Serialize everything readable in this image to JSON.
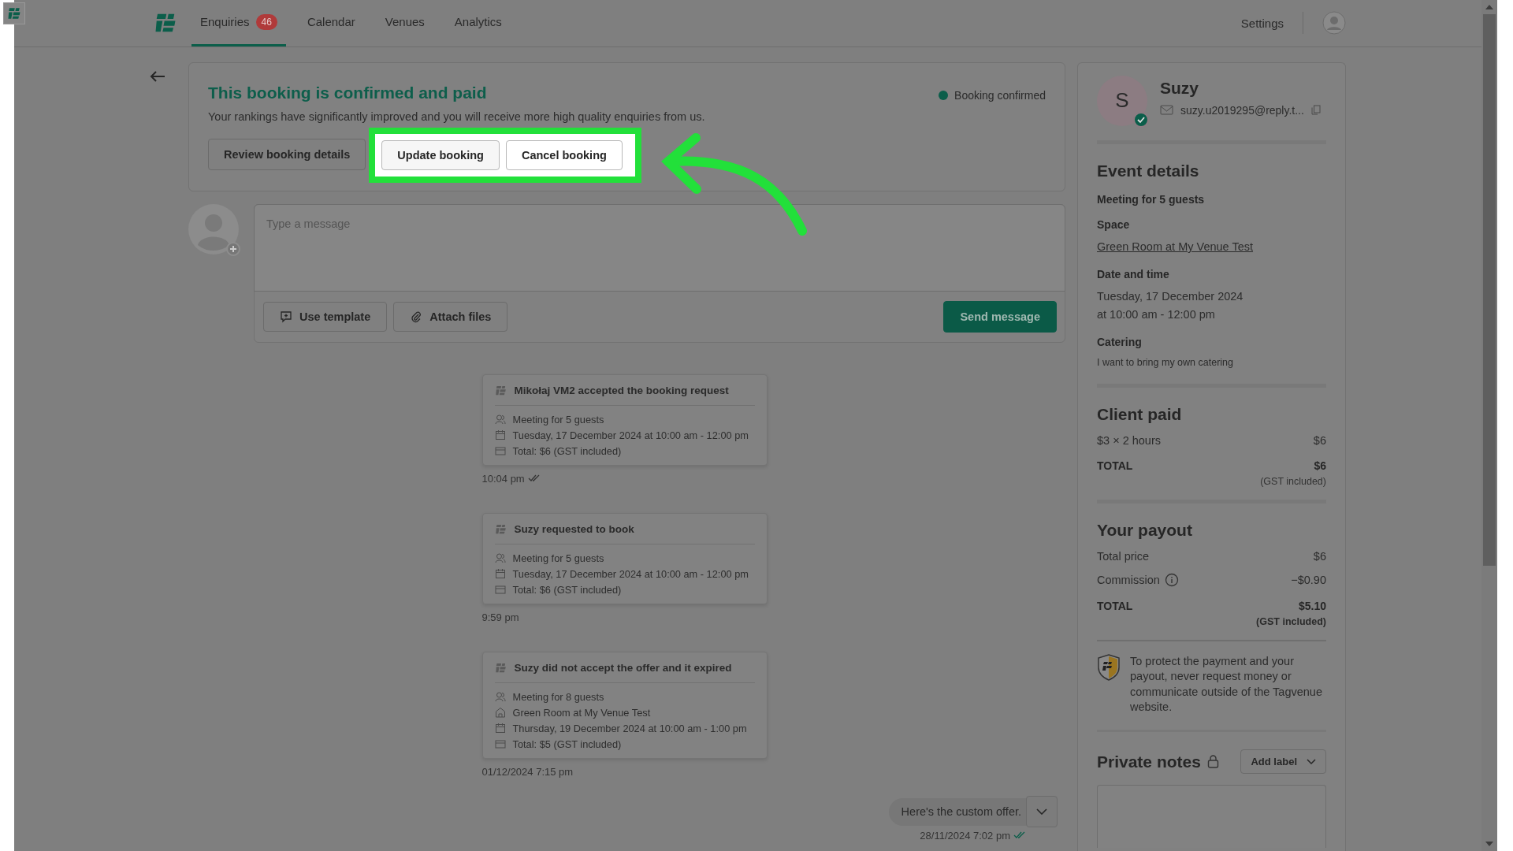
{
  "nav": {
    "tabs": [
      {
        "label": "Enquiries",
        "badge": "46",
        "selected": true
      },
      {
        "label": "Calendar",
        "selected": false
      },
      {
        "label": "Venues",
        "selected": false
      },
      {
        "label": "Analytics",
        "selected": false
      }
    ],
    "settings": "Settings"
  },
  "banner": {
    "title": "This booking is confirmed and paid",
    "subtitle": "Your rankings have significantly improved and you will receive more high quality enquiries from us.",
    "status": {
      "label": "Booking confirmed",
      "color": "#0b5e4a"
    },
    "buttons": [
      {
        "label": "Review booking details",
        "highlighted": false
      },
      {
        "label": "Update booking",
        "highlighted": true
      },
      {
        "label": "Cancel booking",
        "highlighted": true
      }
    ]
  },
  "composer": {
    "placeholder": "Type a message",
    "tools": [
      {
        "kind": "template",
        "label": "Use template"
      },
      {
        "kind": "attach",
        "label": "Attach files"
      }
    ],
    "send": "Send message"
  },
  "timeline": [
    {
      "title": "Mikołaj VM2 accepted the booking request",
      "lines": [
        {
          "kind": "guests",
          "text": "Meeting for 5 guests"
        },
        {
          "kind": "date",
          "text": "Tuesday, 17 December 2024 at 10:00 am - 12:00 pm"
        },
        {
          "kind": "total",
          "text": "Total: $6 (GST included)"
        }
      ],
      "time": "10:04 pm",
      "read": true
    },
    {
      "title": "Suzy requested to book",
      "lines": [
        {
          "kind": "guests",
          "text": "Meeting for 5 guests"
        },
        {
          "kind": "date",
          "text": "Tuesday, 17 December 2024 at 10:00 am - 12:00 pm"
        },
        {
          "kind": "total",
          "text": "Total: $6 (GST included)"
        }
      ],
      "time": "9:59 pm",
      "read": false
    },
    {
      "title": "Suzy did not accept the offer and it expired",
      "lines": [
        {
          "kind": "guests",
          "text": "Meeting for 8 guests"
        },
        {
          "kind": "venue",
          "text": "Green Room at My Venue Test"
        },
        {
          "kind": "date",
          "text": "Thursday, 19 December 2024 at 10:00 am - 1:00 pm"
        },
        {
          "kind": "total",
          "text": "Total: $5 (GST included)"
        }
      ],
      "time": "01/12/2024 7:15 pm",
      "read": false
    }
  ],
  "message": {
    "text": "Here's the custom offer.",
    "time": "28/11/2024 7:02 pm",
    "read": true
  },
  "client": {
    "initial": "S",
    "name": "Suzy",
    "email": "suzy.u2019295@reply.t...",
    "verified": true
  },
  "event": {
    "heading": "Event details",
    "summary": "Meeting for 5 guests",
    "space_label": "Space",
    "space": "Green Room at My Venue Test",
    "date_label": "Date and time",
    "date_lines": [
      "Tuesday, 17 December 2024",
      "at 10:00 am - 12:00 pm"
    ],
    "catering_label": "Catering",
    "catering": "I want to bring my own catering"
  },
  "client_paid": {
    "heading": "Client paid",
    "rows": [
      {
        "label": "$3 × 2 hours",
        "value": "$6"
      }
    ],
    "total_label": "TOTAL",
    "total": "$6",
    "note": "(GST included)"
  },
  "payout": {
    "heading": "Your payout",
    "rows": [
      {
        "label": "Total price",
        "value": "$6",
        "info": false
      },
      {
        "label": "Commission",
        "value": "−$0.90",
        "info": true
      }
    ],
    "total_label": "TOTAL",
    "total": "$5.10",
    "note": "(GST included)"
  },
  "notice": "To protect the payment and your payout, never request money or communicate outside of the Tagvenue website.",
  "notes": {
    "heading": "Private notes",
    "add_label": "Add label"
  }
}
